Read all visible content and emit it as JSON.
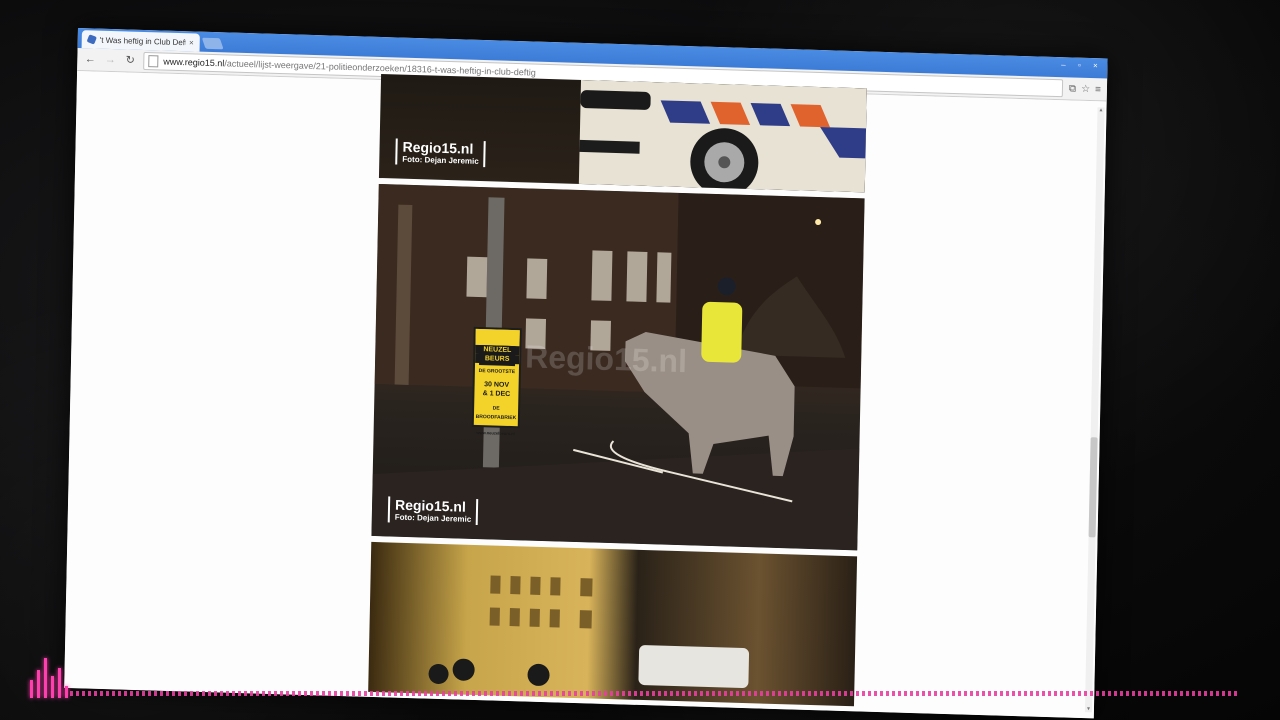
{
  "browser": {
    "tab_title": "'t Was heftig in Club Deft",
    "tab_close": "×",
    "url_host": "www.regio15.nl",
    "url_path": "/actueel/lijst-weergave/21-politieonderzoeken/18316-t-was-heftig-in-club-deftig",
    "window_controls": [
      "–",
      "▫",
      "×"
    ]
  },
  "toolbar": {
    "back": "←",
    "forward": "→",
    "reload": "↻",
    "star": "☆",
    "menu": "≡",
    "extension": "⧉"
  },
  "photos": [
    {
      "brand": "Regio15.nl",
      "credit": "Foto: Dejan Jeremic"
    },
    {
      "brand": "Regio15.nl",
      "credit": "Foto: Dejan Jeremic",
      "center_watermark": "Regio15.nl",
      "poster": [
        "NEUZEL",
        "BEURS",
        "DE GROOTSTE",
        "30 NOV",
        "& 1 DEC",
        "DE BROODFABRIEK",
        "www.neuzelbeurs.nl"
      ]
    },
    {}
  ],
  "colors": {
    "accent": "#3d7cd6",
    "equalizer": "#ff3fae",
    "background": "#0c0c0d"
  }
}
